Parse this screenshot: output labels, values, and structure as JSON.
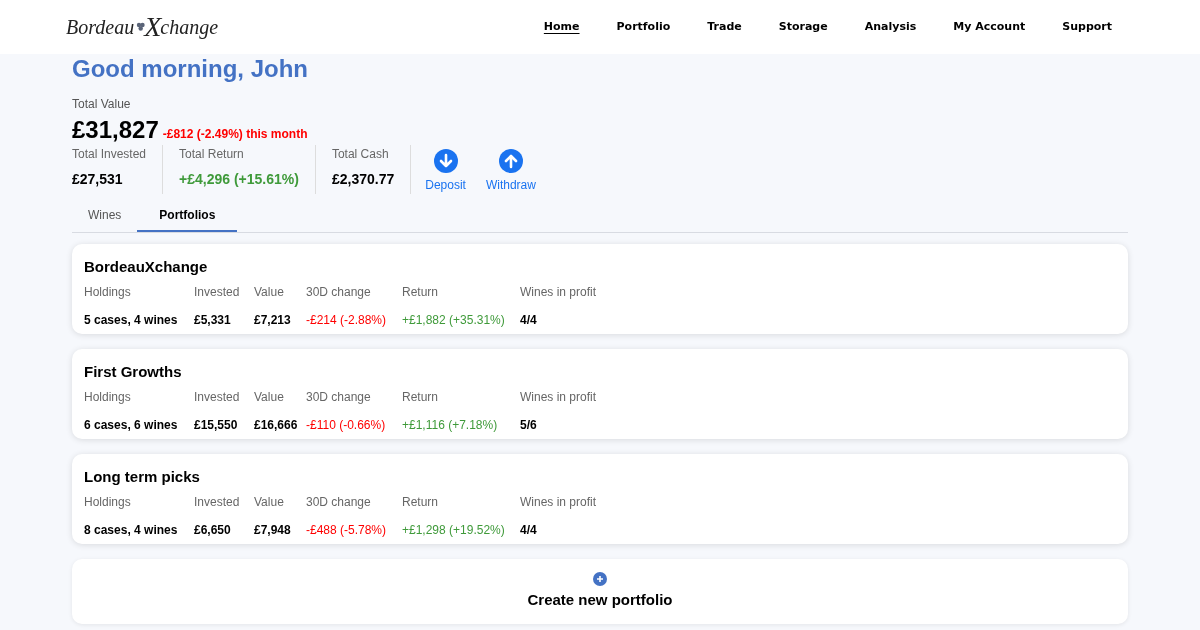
{
  "logo": {
    "before": "Bordeau",
    "mark": "X",
    "after": "change"
  },
  "nav": [
    {
      "label": "Home",
      "selected": true
    },
    {
      "label": "Portfolio",
      "selected": false
    },
    {
      "label": "Trade",
      "selected": false
    },
    {
      "label": "Storage",
      "selected": false
    },
    {
      "label": "Analysis",
      "selected": false
    },
    {
      "label": "My Account",
      "selected": false
    },
    {
      "label": "Support",
      "selected": false
    }
  ],
  "greeting": "Good morning, John",
  "total_value": {
    "label": "Total Value",
    "value": "£31,827",
    "change": {
      "text": "-£812 (-2.49%) this month",
      "kind": "loss"
    }
  },
  "stats": [
    {
      "label": "Total Invested",
      "value": "£27,531",
      "kind": "plain"
    },
    {
      "label": "Total Return",
      "value": "+£4,296 (+15.61%)",
      "kind": "gain"
    },
    {
      "label": "Total Cash",
      "value": "£2,370.77",
      "kind": "plain"
    }
  ],
  "actions": [
    {
      "kind": "down",
      "label": "Deposit"
    },
    {
      "kind": "up",
      "label": "Withdraw"
    }
  ],
  "tabs": [
    {
      "label": "Wines",
      "selected": false
    },
    {
      "label": "Portfolios",
      "selected": true
    }
  ],
  "portfolios": [
    {
      "name": "BordeauXchange",
      "cells": [
        {
          "label": "Holdings",
          "value": "5 cases, 4 wines",
          "kind": "plain"
        },
        {
          "label": "Invested",
          "value": "£5,331",
          "kind": "plain"
        },
        {
          "label": "Value",
          "value": "£7,213",
          "kind": "plain"
        },
        {
          "label": "30D change",
          "value": "-£214 (-2.88%)",
          "kind": "loss"
        },
        {
          "label": "Return",
          "value": "+£1,882 (+35.31%)",
          "kind": "gain"
        },
        {
          "label": "Wines in profit",
          "value": "4/4",
          "kind": "plain"
        }
      ]
    },
    {
      "name": "First Growths",
      "cells": [
        {
          "label": "Holdings",
          "value": "6 cases, 6 wines",
          "kind": "plain"
        },
        {
          "label": "Invested",
          "value": "£15,550",
          "kind": "plain"
        },
        {
          "label": "Value",
          "value": "£16,666",
          "kind": "plain"
        },
        {
          "label": "30D change",
          "value": "-£110 (-0.66%)",
          "kind": "loss"
        },
        {
          "label": "Return",
          "value": "+£1,116 (+7.18%)",
          "kind": "gain"
        },
        {
          "label": "Wines in profit",
          "value": "5/6",
          "kind": "plain"
        }
      ]
    },
    {
      "name": "Long term picks",
      "cells": [
        {
          "label": "Holdings",
          "value": "8 cases, 4 wines",
          "kind": "plain"
        },
        {
          "label": "Invested",
          "value": "£6,650",
          "kind": "plain"
        },
        {
          "label": "Value",
          "value": "£7,948",
          "kind": "plain"
        },
        {
          "label": "30D change",
          "value": "-£488 (-5.78%)",
          "kind": "loss"
        },
        {
          "label": "Return",
          "value": "+£1,298 (+19.52%)",
          "kind": "gain"
        },
        {
          "label": "Wines in profit",
          "value": "4/4",
          "kind": "plain"
        }
      ]
    }
  ],
  "create_button": "Create new portfolio"
}
